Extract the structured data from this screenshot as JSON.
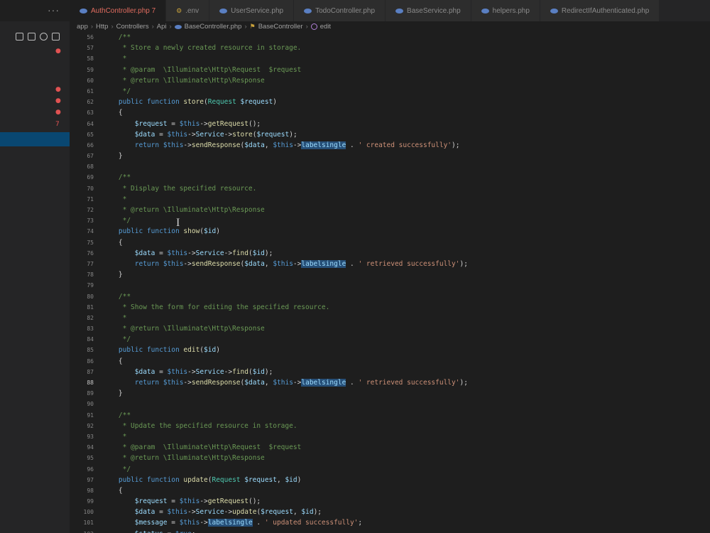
{
  "sidebar": {
    "more_label": "···",
    "markers": [
      "●",
      "●",
      "●",
      "●",
      "7"
    ]
  },
  "tabs": [
    {
      "label": "AuthController.php 7",
      "icon": "php-file-icon",
      "active": true
    },
    {
      "label": ".env",
      "icon": "env-file-icon",
      "active": false
    },
    {
      "label": "UserService.php",
      "icon": "php-file-icon",
      "active": false
    },
    {
      "label": "TodoController.php",
      "icon": "php-file-icon",
      "active": false
    },
    {
      "label": "BaseService.php",
      "icon": "php-file-icon",
      "active": false
    },
    {
      "label": "helpers.php",
      "icon": "php-file-icon",
      "active": false
    },
    {
      "label": "RedirectIfAuthenticated.php",
      "icon": "php-file-icon",
      "active": false
    }
  ],
  "breadcrumb": [
    "app",
    "Http",
    "Controllers",
    "Api",
    "BaseController.php",
    "BaseController",
    "edit"
  ],
  "editor": {
    "current_line": 88,
    "lines": [
      {
        "n": 56,
        "t": [
          [
            "    /**",
            "cm"
          ]
        ]
      },
      {
        "n": 57,
        "t": [
          [
            "     * Store a newly created resource in storage.",
            "cm"
          ]
        ]
      },
      {
        "n": 58,
        "t": [
          [
            "     *",
            "cm"
          ]
        ]
      },
      {
        "n": 59,
        "t": [
          [
            "     * @param  \\Illuminate\\Http\\Request  $request",
            "cm"
          ]
        ]
      },
      {
        "n": 60,
        "t": [
          [
            "     * @return \\Illuminate\\Http\\Response",
            "cm"
          ]
        ]
      },
      {
        "n": 61,
        "t": [
          [
            "     */",
            "cm"
          ]
        ]
      },
      {
        "n": 62,
        "t": [
          [
            "    ",
            ""
          ],
          [
            "public function ",
            "kw"
          ],
          [
            "store",
            "fn"
          ],
          [
            "(",
            ""
          ],
          [
            "Request ",
            "ty"
          ],
          [
            "$request",
            "vr"
          ],
          [
            ")",
            ""
          ]
        ]
      },
      {
        "n": 63,
        "t": [
          [
            "    {",
            ""
          ]
        ]
      },
      {
        "n": 64,
        "t": [
          [
            "        ",
            ""
          ],
          [
            "$request",
            "vr"
          ],
          [
            " = ",
            ""
          ],
          [
            "$this",
            "kw"
          ],
          [
            "->",
            ""
          ],
          [
            "getRequest",
            "fn"
          ],
          [
            "();",
            ""
          ]
        ]
      },
      {
        "n": 65,
        "t": [
          [
            "        ",
            ""
          ],
          [
            "$data",
            "vr"
          ],
          [
            " = ",
            ""
          ],
          [
            "$this",
            "kw"
          ],
          [
            "->",
            ""
          ],
          [
            "Service",
            "vr"
          ],
          [
            "->",
            ""
          ],
          [
            "store",
            "fn"
          ],
          [
            "(",
            ""
          ],
          [
            "$request",
            "vr"
          ],
          [
            ");",
            ""
          ]
        ]
      },
      {
        "n": 66,
        "t": [
          [
            "        ",
            ""
          ],
          [
            "return ",
            "kw"
          ],
          [
            "$this",
            "kw"
          ],
          [
            "->",
            ""
          ],
          [
            "sendResponse",
            "fn"
          ],
          [
            "(",
            ""
          ],
          [
            "$data",
            "vr"
          ],
          [
            ", ",
            ""
          ],
          [
            "$this",
            "kw"
          ],
          [
            "->",
            ""
          ],
          [
            "labelsingle",
            "hl"
          ],
          [
            " . ",
            ""
          ],
          [
            "' created successfully'",
            "st"
          ],
          [
            ");",
            ""
          ]
        ]
      },
      {
        "n": 67,
        "t": [
          [
            "    }",
            ""
          ]
        ]
      },
      {
        "n": 68,
        "t": []
      },
      {
        "n": 69,
        "t": [
          [
            "    /**",
            "cm"
          ]
        ]
      },
      {
        "n": 70,
        "t": [
          [
            "     * Display the specified resource.",
            "cm"
          ]
        ]
      },
      {
        "n": 71,
        "t": [
          [
            "     *",
            "cm"
          ]
        ]
      },
      {
        "n": 72,
        "t": [
          [
            "     * @return \\Illuminate\\Http\\Response",
            "cm"
          ]
        ]
      },
      {
        "n": 73,
        "t": [
          [
            "     */",
            "cm"
          ]
        ]
      },
      {
        "n": 74,
        "t": [
          [
            "    ",
            ""
          ],
          [
            "public function ",
            "kw"
          ],
          [
            "show",
            "fn"
          ],
          [
            "(",
            ""
          ],
          [
            "$id",
            "vr"
          ],
          [
            ")",
            ""
          ]
        ]
      },
      {
        "n": 75,
        "t": [
          [
            "    {",
            ""
          ]
        ]
      },
      {
        "n": 76,
        "t": [
          [
            "        ",
            ""
          ],
          [
            "$data",
            "vr"
          ],
          [
            " = ",
            ""
          ],
          [
            "$this",
            "kw"
          ],
          [
            "->",
            ""
          ],
          [
            "Service",
            "vr"
          ],
          [
            "->",
            ""
          ],
          [
            "find",
            "fn"
          ],
          [
            "(",
            ""
          ],
          [
            "$id",
            "vr"
          ],
          [
            ");",
            ""
          ]
        ]
      },
      {
        "n": 77,
        "t": [
          [
            "        ",
            ""
          ],
          [
            "return ",
            "kw"
          ],
          [
            "$this",
            "kw"
          ],
          [
            "->",
            ""
          ],
          [
            "sendResponse",
            "fn"
          ],
          [
            "(",
            ""
          ],
          [
            "$data",
            "vr"
          ],
          [
            ", ",
            ""
          ],
          [
            "$this",
            "kw"
          ],
          [
            "->",
            ""
          ],
          [
            "labelsingle",
            "hl"
          ],
          [
            " . ",
            ""
          ],
          [
            "' retrieved successfully'",
            "st"
          ],
          [
            ");",
            ""
          ]
        ]
      },
      {
        "n": 78,
        "t": [
          [
            "    }",
            ""
          ]
        ]
      },
      {
        "n": 79,
        "t": []
      },
      {
        "n": 80,
        "t": [
          [
            "    /**",
            "cm"
          ]
        ]
      },
      {
        "n": 81,
        "t": [
          [
            "     * Show the form for editing the specified resource.",
            "cm"
          ]
        ]
      },
      {
        "n": 82,
        "t": [
          [
            "     *",
            "cm"
          ]
        ]
      },
      {
        "n": 83,
        "t": [
          [
            "     * @return \\Illuminate\\Http\\Response",
            "cm"
          ]
        ]
      },
      {
        "n": 84,
        "t": [
          [
            "     */",
            "cm"
          ]
        ]
      },
      {
        "n": 85,
        "t": [
          [
            "    ",
            ""
          ],
          [
            "public function ",
            "kw"
          ],
          [
            "edit",
            "fn"
          ],
          [
            "(",
            ""
          ],
          [
            "$id",
            "vr"
          ],
          [
            ")",
            ""
          ]
        ]
      },
      {
        "n": 86,
        "t": [
          [
            "    {",
            ""
          ]
        ]
      },
      {
        "n": 87,
        "t": [
          [
            "        ",
            ""
          ],
          [
            "$data",
            "vr"
          ],
          [
            " = ",
            ""
          ],
          [
            "$this",
            "kw"
          ],
          [
            "->",
            ""
          ],
          [
            "Service",
            "vr"
          ],
          [
            "->",
            ""
          ],
          [
            "find",
            "fn"
          ],
          [
            "(",
            ""
          ],
          [
            "$id",
            "vr"
          ],
          [
            ");",
            ""
          ]
        ]
      },
      {
        "n": 88,
        "t": [
          [
            "        ",
            ""
          ],
          [
            "return ",
            "kw"
          ],
          [
            "$this",
            "kw"
          ],
          [
            "->",
            ""
          ],
          [
            "sendResponse",
            "fn"
          ],
          [
            "(",
            ""
          ],
          [
            "$data",
            "vr"
          ],
          [
            ", ",
            ""
          ],
          [
            "$this",
            "kw"
          ],
          [
            "->",
            ""
          ],
          [
            "labelsingle",
            "hl"
          ],
          [
            " . ",
            ""
          ],
          [
            "' retrieved successfully'",
            "st"
          ],
          [
            ");",
            ""
          ]
        ]
      },
      {
        "n": 89,
        "t": [
          [
            "    }",
            ""
          ]
        ]
      },
      {
        "n": 90,
        "t": []
      },
      {
        "n": 91,
        "t": [
          [
            "    /**",
            "cm"
          ]
        ]
      },
      {
        "n": 92,
        "t": [
          [
            "     * Update the specified resource in storage.",
            "cm"
          ]
        ]
      },
      {
        "n": 93,
        "t": [
          [
            "     *",
            "cm"
          ]
        ]
      },
      {
        "n": 94,
        "t": [
          [
            "     * @param  \\Illuminate\\Http\\Request  $request",
            "cm"
          ]
        ]
      },
      {
        "n": 95,
        "t": [
          [
            "     * @return \\Illuminate\\Http\\Response",
            "cm"
          ]
        ]
      },
      {
        "n": 96,
        "t": [
          [
            "     */",
            "cm"
          ]
        ]
      },
      {
        "n": 97,
        "t": [
          [
            "    ",
            ""
          ],
          [
            "public function ",
            "kw"
          ],
          [
            "update",
            "fn"
          ],
          [
            "(",
            ""
          ],
          [
            "Request ",
            "ty"
          ],
          [
            "$request",
            "vr"
          ],
          [
            ", ",
            ""
          ],
          [
            "$id",
            "vr"
          ],
          [
            ")",
            ""
          ]
        ]
      },
      {
        "n": 98,
        "t": [
          [
            "    {",
            ""
          ]
        ]
      },
      {
        "n": 99,
        "t": [
          [
            "        ",
            ""
          ],
          [
            "$request",
            "vr"
          ],
          [
            " = ",
            ""
          ],
          [
            "$this",
            "kw"
          ],
          [
            "->",
            ""
          ],
          [
            "getRequest",
            "fn"
          ],
          [
            "();",
            ""
          ]
        ]
      },
      {
        "n": 100,
        "t": [
          [
            "        ",
            ""
          ],
          [
            "$data",
            "vr"
          ],
          [
            " = ",
            ""
          ],
          [
            "$this",
            "kw"
          ],
          [
            "->",
            ""
          ],
          [
            "Service",
            "vr"
          ],
          [
            "->",
            ""
          ],
          [
            "update",
            "fn"
          ],
          [
            "(",
            ""
          ],
          [
            "$request",
            "vr"
          ],
          [
            ", ",
            ""
          ],
          [
            "$id",
            "vr"
          ],
          [
            ");",
            ""
          ]
        ]
      },
      {
        "n": 101,
        "t": [
          [
            "        ",
            ""
          ],
          [
            "$message",
            "vr"
          ],
          [
            " = ",
            ""
          ],
          [
            "$this",
            "kw"
          ],
          [
            "->",
            ""
          ],
          [
            "labelsingle",
            "hl"
          ],
          [
            " . ",
            ""
          ],
          [
            "' updated successfully'",
            "st"
          ],
          [
            ";",
            ""
          ]
        ]
      },
      {
        "n": 102,
        "t": [
          [
            "        ",
            ""
          ],
          [
            "$status",
            "vr"
          ],
          [
            " = ",
            ""
          ],
          [
            "true",
            "kw"
          ],
          [
            ";",
            ""
          ]
        ]
      }
    ]
  }
}
